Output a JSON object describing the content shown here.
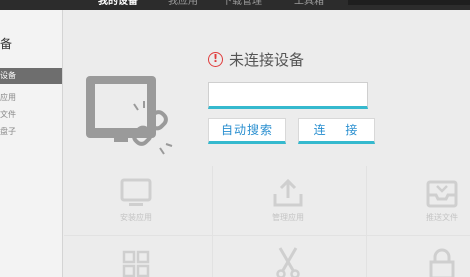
{
  "topnav": {
    "tabs": [
      {
        "label": "我的设备",
        "active": true
      },
      {
        "label": "我应用",
        "active": false
      },
      {
        "label": "下载管理",
        "active": false
      },
      {
        "label": "工具箱",
        "active": false
      }
    ]
  },
  "sidebar": {
    "title": "备",
    "items": [
      {
        "label": "设备",
        "active": true
      },
      {
        "label": "应用",
        "active": false
      },
      {
        "label": "文件",
        "active": false
      },
      {
        "label": "盘子",
        "active": false
      }
    ]
  },
  "device": {
    "status_icon": "warning-icon",
    "status_text": "未连接设备",
    "code_input_value": "",
    "search_button": "自动搜索",
    "connect_button": "连 接"
  },
  "features": [
    {
      "label": "安装应用",
      "icon": "monitor-icon"
    },
    {
      "label": "管理应用",
      "icon": "upload-icon"
    },
    {
      "label": "推送文件",
      "icon": "inbox-icon"
    },
    {
      "label": "",
      "icon": "grid-apps-icon"
    },
    {
      "label": "",
      "icon": "scissors-icon"
    },
    {
      "label": "",
      "icon": "lock-icon"
    }
  ],
  "colors": {
    "accent": "#35b9ce",
    "button_text": "#2a8fd0",
    "warning": "#e03c3c",
    "sidebar_active": "#6e6e6e",
    "topbar": "#2c2c2c"
  }
}
